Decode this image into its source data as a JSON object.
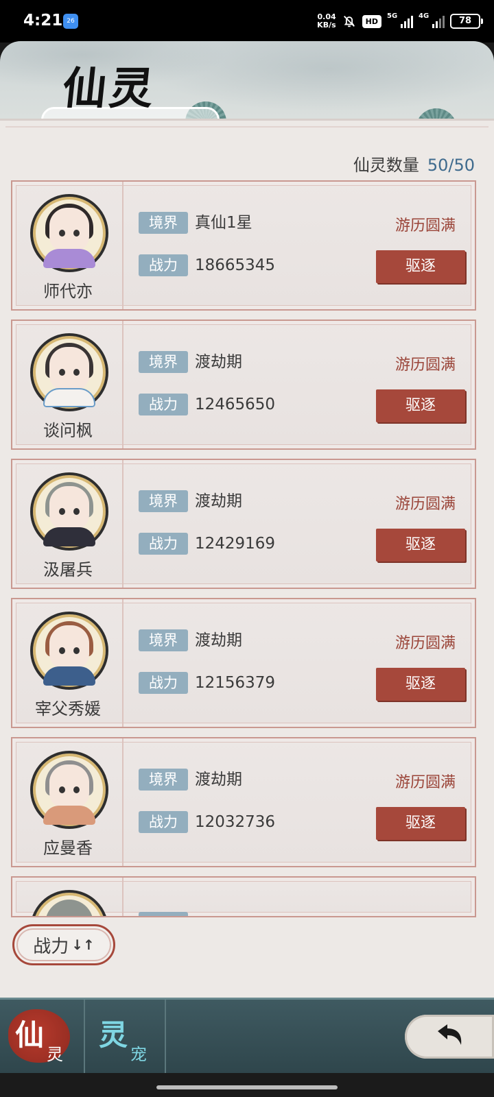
{
  "status_bar": {
    "time": "4:21",
    "app_badge": "26",
    "net_speed_value": "0.04",
    "net_speed_unit": "KB/s",
    "hd": "HD",
    "sim1": "5G",
    "sim2": "4G",
    "battery": "78"
  },
  "page": {
    "title": "仙灵",
    "count_label": "仙灵数量",
    "count_value": "50/50",
    "tag_realm": "境界",
    "tag_power": "战力",
    "expel_label": "驱逐"
  },
  "spirits": [
    {
      "name": "师代亦",
      "realm": "真仙1星",
      "power": "18665345",
      "status": "游历圆满",
      "hair_color": "#2f2a2a",
      "robe_color": "#a98bd6"
    },
    {
      "name": "谈问枫",
      "realm": "渡劫期",
      "power": "12465650",
      "status": "游历圆满",
      "hair_color": "#3a3535",
      "robe_color": "#f4f1ee"
    },
    {
      "name": "汲屠兵",
      "realm": "渡劫期",
      "power": "12429169",
      "status": "游历圆满",
      "hair_color": "#8e948f",
      "robe_color": "#2f2f3a"
    },
    {
      "name": "宰父秀媛",
      "realm": "渡劫期",
      "power": "12156379",
      "status": "游历圆满",
      "hair_color": "#9a5d42",
      "robe_color": "#3d5f8c"
    },
    {
      "name": "应曼香",
      "realm": "渡劫期",
      "power": "12032736",
      "status": "游历圆满",
      "hair_color": "#8f8f8f",
      "robe_color": "#d99a7a"
    }
  ],
  "sort": {
    "label": "战力",
    "arrows": "↓↑"
  },
  "bottom_nav": {
    "tabs": [
      {
        "main": "仙",
        "sub": "灵",
        "active": true
      },
      {
        "main": "灵",
        "sub": "宠",
        "active": false
      }
    ]
  },
  "colors": {
    "accent_red": "#a6483b",
    "tag_blue": "#93aebe",
    "count_blue": "#3e6a8d",
    "nav_teal": "#3f5a61"
  }
}
